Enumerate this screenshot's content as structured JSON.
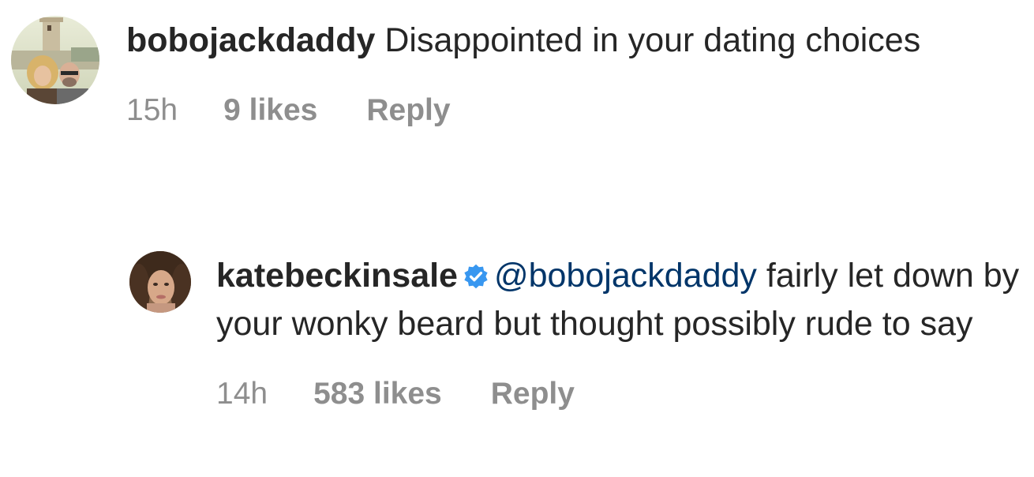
{
  "comments": [
    {
      "username": "bobojackdaddy",
      "text": " Disappointed in your dating choices",
      "time": "15h",
      "likes": "9 likes",
      "reply_label": "Reply"
    }
  ],
  "reply": {
    "username": "katebeckinsale",
    "verified": true,
    "mention": "@bobojackdaddy",
    "text": " fairly let down by your wonky beard but thought possibly rude to say",
    "time": "14h",
    "likes": "583 likes",
    "reply_label": "Reply"
  },
  "colors": {
    "text": "#262626",
    "meta": "#8e8e8e",
    "mention": "#003569",
    "verified_badge": "#3897f0"
  },
  "icons": {
    "verified": "verified-badge-icon"
  }
}
